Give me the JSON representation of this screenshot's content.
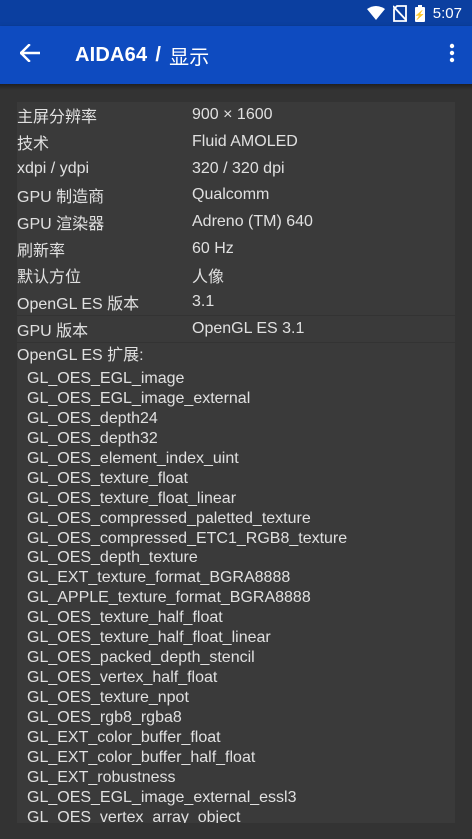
{
  "status_bar": {
    "time": "5:07",
    "icons": [
      "wifi-icon",
      "no-sim-icon",
      "battery-icon"
    ]
  },
  "app_bar": {
    "app_name": "AIDA64",
    "separator": "/",
    "page_title": "显示",
    "back_icon": "arrow-back-icon",
    "menu_icon": "overflow-menu-icon"
  },
  "info_rows": [
    {
      "label": "主屏分辨率",
      "value": "900 × 1600"
    },
    {
      "label": "技术",
      "value": "Fluid AMOLED"
    },
    {
      "label": "xdpi / ydpi",
      "value": "320 / 320 dpi"
    },
    {
      "label": "GPU 制造商",
      "value": "Qualcomm"
    },
    {
      "label": "GPU 渲染器",
      "value": "Adreno (TM) 640"
    },
    {
      "label": "刷新率",
      "value": "60 Hz"
    },
    {
      "label": "默认方位",
      "value": "人像"
    },
    {
      "label": "OpenGL ES 版本",
      "value": "3.1"
    },
    {
      "label": "GPU 版本",
      "value": "OpenGL ES 3.1"
    }
  ],
  "extensions": {
    "heading": "OpenGL ES 扩展:",
    "items": [
      "GL_OES_EGL_image",
      "GL_OES_EGL_image_external",
      "GL_OES_depth24",
      "GL_OES_depth32",
      "GL_OES_element_index_uint",
      "GL_OES_texture_float",
      "GL_OES_texture_float_linear",
      "GL_OES_compressed_paletted_texture",
      "GL_OES_compressed_ETC1_RGB8_texture",
      "GL_OES_depth_texture",
      "GL_EXT_texture_format_BGRA8888",
      "GL_APPLE_texture_format_BGRA8888",
      "GL_OES_texture_half_float",
      "GL_OES_texture_half_float_linear",
      "GL_OES_packed_depth_stencil",
      "GL_OES_vertex_half_float",
      "GL_OES_texture_npot",
      "GL_OES_rgb8_rgba8",
      "GL_EXT_color_buffer_float",
      "GL_EXT_color_buffer_half_float",
      "GL_EXT_robustness",
      "GL_OES_EGL_image_external_essl3",
      "GL_OES_vertex_array_object"
    ]
  }
}
